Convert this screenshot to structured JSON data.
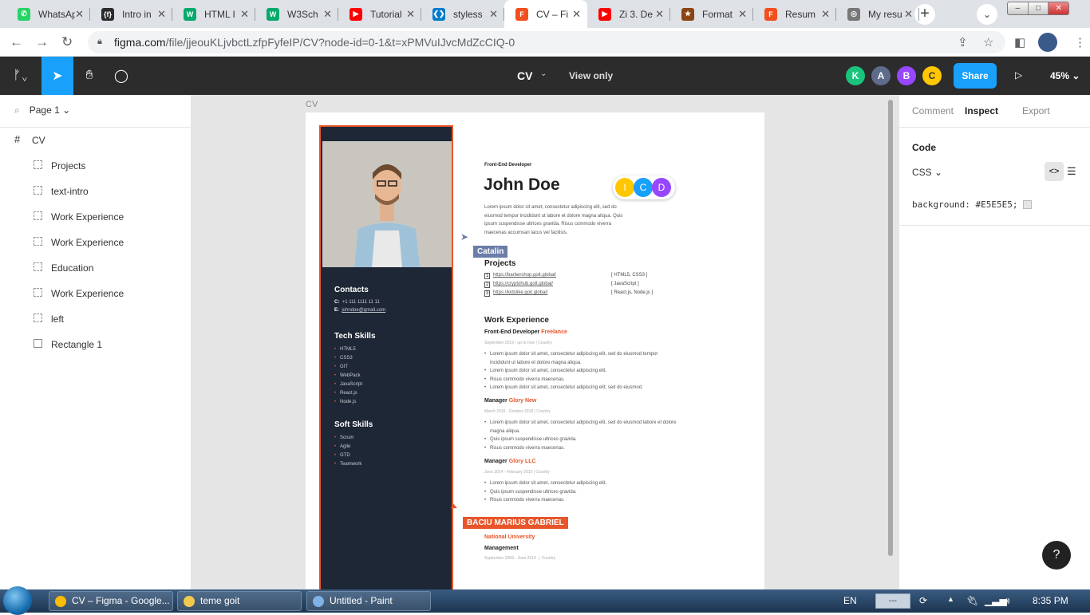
{
  "browser": {
    "tabs": [
      {
        "title": "WhatsApp",
        "color": "#25d366",
        "glyph": "✆"
      },
      {
        "title": "Intro in",
        "color": "#2b2b2b",
        "glyph": "{f}"
      },
      {
        "title": "HTML I",
        "color": "#04aa6d",
        "glyph": "W"
      },
      {
        "title": "W3Sch",
        "color": "#04aa6d",
        "glyph": "W"
      },
      {
        "title": "Tutorial",
        "color": "#ff0000",
        "glyph": "▶"
      },
      {
        "title": "styless",
        "color": "#007acc",
        "glyph": "❮❯"
      },
      {
        "title": "CV – Fi",
        "color": "#f24e1e",
        "glyph": "F",
        "active": true
      },
      {
        "title": "Zi 3. De",
        "color": "#ff0000",
        "glyph": "▶"
      },
      {
        "title": "Format",
        "color": "#8b4513",
        "glyph": "★"
      },
      {
        "title": "Resum",
        "color": "#f24e1e",
        "glyph": "F"
      },
      {
        "title": "My resu",
        "color": "#777777",
        "glyph": "◎"
      }
    ],
    "url_host": "figma.com",
    "url_path": "/file/jjeouKLjvbctLzfpFyfeIP/CV?node-id=0-1&t=xPMVuIJvcMdZcCIQ-0"
  },
  "figma": {
    "file_title": "CV",
    "view_mode": "View only",
    "avatars": [
      {
        "letter": "K",
        "color": "#1bc47d",
        "fg": "#ffffff"
      },
      {
        "letter": "A",
        "color": "#5f6b8a",
        "fg": "#ffffff"
      },
      {
        "letter": "B",
        "color": "#9747ff",
        "fg": "#ffffff"
      },
      {
        "letter": "C",
        "color": "#ffc700",
        "fg": "#333333"
      }
    ],
    "share_label": "Share",
    "zoom": "45%",
    "page": "Page 1",
    "layers": [
      "Projects",
      "text-intro",
      "Work Experience",
      "Work Experience",
      "Education",
      "Work Experience",
      "left",
      "Rectangle 1"
    ],
    "top_layer": "CV",
    "canvas_label": "CV",
    "inspect": {
      "tabs": [
        "Comment",
        "Inspect",
        "Export"
      ],
      "code_heading": "Code",
      "lang": "CSS",
      "code_line": "background: #E5E5E5;"
    }
  },
  "cv": {
    "role": "Front-End Developer",
    "name": "John Doe",
    "intro": "Lorem ipsum dolor sit amet, consectetur adipiscing elit, sed do eiusmod tempor incididunt ut labore et dolore magna aliqua. Quis ipsum suspendisse ultrices gravida. Risus commodo viverra maecenas accumsan lacus vel facilisis.",
    "contacts_heading": "Contacts",
    "phone_label": "C:",
    "phone": "+1 111 1111 11 11",
    "email_label": "E:",
    "email": "johndoe@gmail.com",
    "tech_heading": "Tech Skills",
    "tech_skills": [
      "HTML5",
      "CSS3",
      "GIT",
      "WebPack",
      "JavaScript",
      "React.js",
      "Node.js"
    ],
    "soft_heading": "Soft Skills",
    "soft_skills": [
      "Scrum",
      "Agile",
      "GTD",
      "Teamwork"
    ],
    "projects_heading": "Projects",
    "projects": [
      {
        "num": "1",
        "url": "https://barbershop.goit.global/",
        "tech": "[ HTML5, CSS3 ]"
      },
      {
        "num": "2",
        "url": "https://cryptohub.goit.global/",
        "tech": "[ JavaScript ]"
      },
      {
        "num": "3",
        "url": "https://kidslike.goit.global/",
        "tech": "[ React.js, Node.js ]"
      }
    ],
    "work_heading": "Work Experience",
    "jobs": [
      {
        "title": "Front-End Developer",
        "company": "Freelance",
        "period": "September 2019 - up to now",
        "place": "Country",
        "bullets": [
          "Lorem ipsum dolor sit amet, consectetur adipiscing elit, sed do eiusmod tempor incididunt ut labore et dolore magna aliqua.",
          "Lorem ipsum dolor sit amet, consectetur adipiscing elit.",
          "Risus commodo viverra maecenas.",
          "Lorem ipsum dolor sit amet, consectetur adipiscing elit, sed do eiusmod."
        ]
      },
      {
        "title": "Manager",
        "company": "Glory New",
        "period": "March 2015 - October 2018",
        "place": "Country",
        "bullets": [
          "Lorem ipsum dolor sit amet, consectetur adipiscing elit, sed do eiusmod labore et dolore magna aliqua.",
          "Quis ipsum suspendisse ultrices gravida.",
          "Risus commodo viverra maecenas."
        ]
      },
      {
        "title": "Manager",
        "company": "Glory LLC",
        "period": "June 2014 - February 2015",
        "place": "Country",
        "bullets": [
          "Lorem ipsum dolor sit amet, consectetur adipiscing elit.",
          "Quis ipsum suspendisse ultrices gravida.",
          "Risus commodo viverra maecenas."
        ]
      }
    ],
    "edu_school": "National University",
    "edu_field": "Management",
    "edu_period": "September 2009 - June 2014",
    "edu_place": "Country"
  },
  "collab": {
    "cursor1": "Catalin",
    "cursor2": "BACIU MARIUS GABRIEL",
    "canvas_avatars": [
      {
        "letter": "I",
        "color": "#ffc700"
      },
      {
        "letter": "C",
        "color": "#18a0fb"
      },
      {
        "letter": "D",
        "color": "#9747ff"
      }
    ]
  },
  "taskbar": {
    "items": [
      {
        "label": "CV – Figma - Google...",
        "color": "#fbbc05"
      },
      {
        "label": "teme goit",
        "color": "#f2c94c"
      },
      {
        "label": "Untitled - Paint",
        "color": "#7fb2e5"
      }
    ],
    "lang": "EN",
    "time": "8:35 PM"
  }
}
